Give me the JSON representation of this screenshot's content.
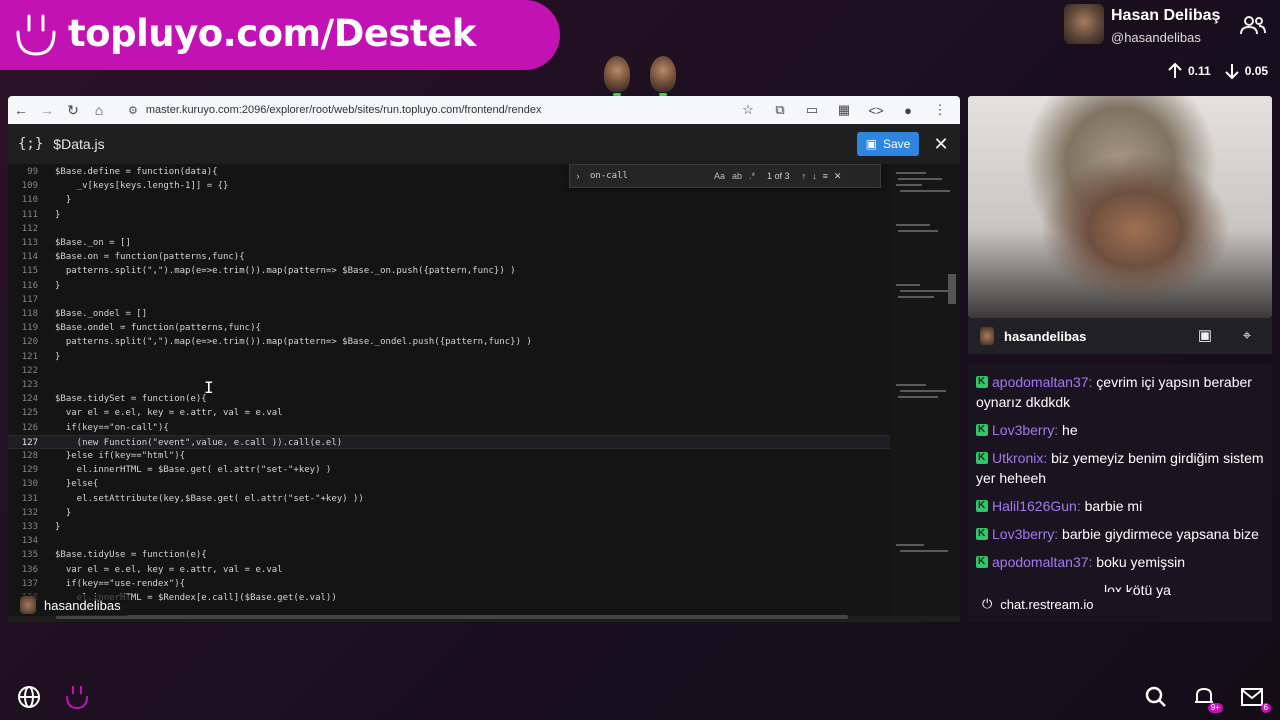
{
  "banner": {
    "text": "topluyo.com/Destek"
  },
  "profile": {
    "name": "Hasan Delibaş",
    "handle": "@hasandelibas"
  },
  "stats": {
    "up": "0.11",
    "down": "0.05"
  },
  "browser": {
    "url": "master.kuruyo.com:2096/explorer/root/web/sites/run.topluyo.com/frontend/rendex"
  },
  "editor": {
    "file_icon": "{;}",
    "file_name": "$Data.js",
    "save_label": "Save",
    "find": {
      "query": "on-call",
      "count": "1 of 3",
      "opt_case": "Aa",
      "opt_word": "ab",
      "opt_regex": ".*"
    },
    "lines": [
      {
        "num": "99",
        "code": "$Base.define = function(data){"
      },
      {
        "num": "109",
        "code": "    _v[keys[keys.length-1]] = {}"
      },
      {
        "num": "110",
        "code": "  }"
      },
      {
        "num": "111",
        "code": "}"
      },
      {
        "num": "112",
        "code": ""
      },
      {
        "num": "113",
        "code": "$Base._on = []"
      },
      {
        "num": "114",
        "code": "$Base.on = function(patterns,func){"
      },
      {
        "num": "115",
        "code": "  patterns.split(\",\").map(e=>e.trim()).map(pattern=> $Base._on.push({pattern,func}) )"
      },
      {
        "num": "116",
        "code": "}"
      },
      {
        "num": "117",
        "code": ""
      },
      {
        "num": "118",
        "code": "$Base._ondel = []"
      },
      {
        "num": "119",
        "code": "$Base.ondel = function(patterns,func){"
      },
      {
        "num": "120",
        "code": "  patterns.split(\",\").map(e=>e.trim()).map(pattern=> $Base._ondel.push({pattern,func}) )"
      },
      {
        "num": "121",
        "code": "}"
      },
      {
        "num": "122",
        "code": ""
      },
      {
        "num": "123",
        "code": ""
      },
      {
        "num": "124",
        "code": "$Base.tidySet = function(e){"
      },
      {
        "num": "125",
        "code": "  var el = e.el, key = e.attr, val = e.val"
      },
      {
        "num": "126",
        "code": "  if(key==\"on-call\"){"
      },
      {
        "num": "127",
        "code": "    (new Function(\"event\",value, e.call )).call(e.el)"
      },
      {
        "num": "128",
        "code": "  }else if(key==\"html\"){"
      },
      {
        "num": "129",
        "code": "    el.innerHTML = $Base.get( el.attr(\"set-\"+key) )"
      },
      {
        "num": "130",
        "code": "  }else{"
      },
      {
        "num": "131",
        "code": "    el.setAttribute(key,$Base.get( el.attr(\"set-\"+key) ))"
      },
      {
        "num": "132",
        "code": "  }"
      },
      {
        "num": "133",
        "code": "}"
      },
      {
        "num": "134",
        "code": ""
      },
      {
        "num": "135",
        "code": "$Base.tidyUse = function(e){"
      },
      {
        "num": "136",
        "code": "  var el = e.el, key = e.attr, val = e.val"
      },
      {
        "num": "137",
        "code": "  if(key==\"use-rendex\"){"
      },
      {
        "num": "138",
        "code": "    el.innerHTML = $Rendex[e.call]($Base.get(e.val))"
      }
    ],
    "overlay_user": "hasandelibas"
  },
  "webcam": {
    "name": "hasandelibas"
  },
  "chat": {
    "messages": [
      {
        "user": "apodomaltan37:",
        "text": " çevrim içi yapsın beraber oynarız dkdkdk"
      },
      {
        "user": "Lov3berry:",
        "text": " he"
      },
      {
        "user": "Utkronix:",
        "text": " biz yemeyiz benim girdiğim sistem yer heheeh"
      },
      {
        "user": "Halil1626Gun:",
        "text": " barbie mi"
      },
      {
        "user": "Lov3berry:",
        "text": " barbie giydirmece yapsana bize"
      },
      {
        "user": "apodomaltan37:",
        "text": " boku yemişsin"
      },
      {
        "user": "",
        "text": "lox kötü ya"
      }
    ],
    "footer": "chat.restream.io"
  },
  "taskbar": {
    "notif_badge": "9+",
    "mail_badge": "6"
  },
  "colors": {
    "brand": "#c312b3",
    "chat_user": "#a477f1",
    "save": "#2e86de"
  }
}
